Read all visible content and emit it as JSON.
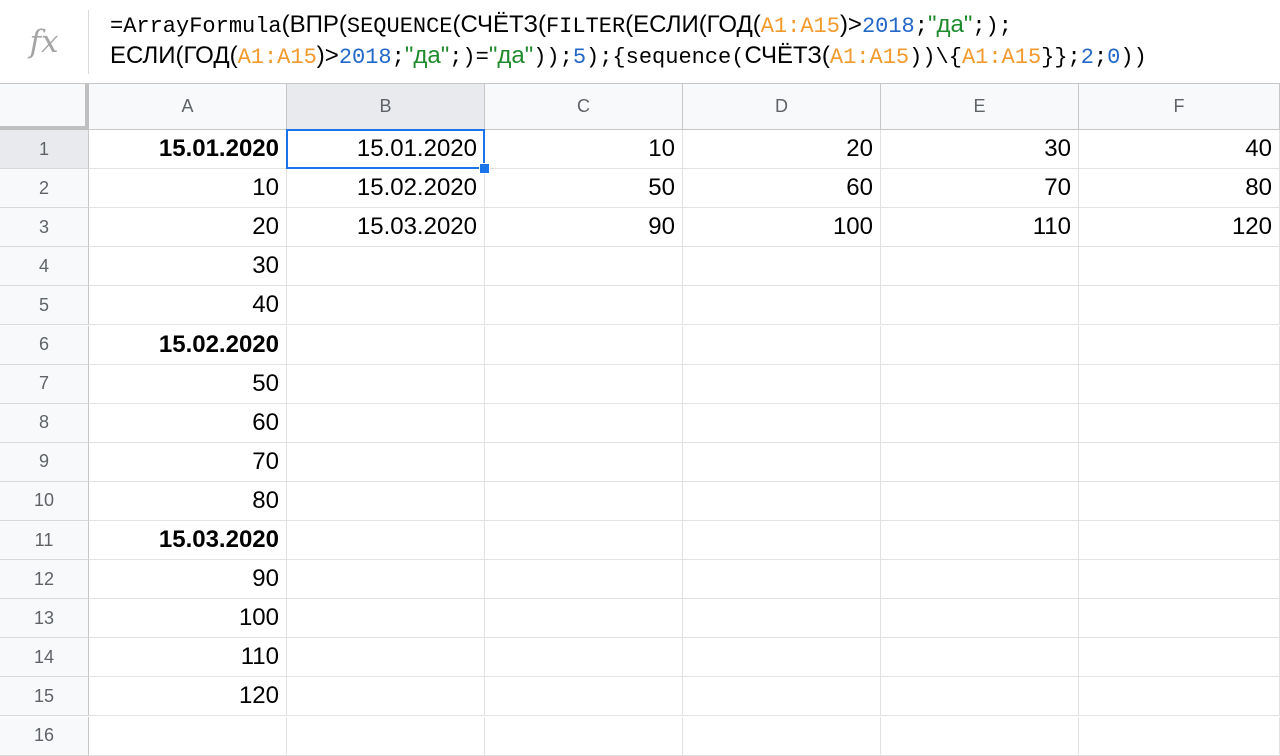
{
  "formula_bar": {
    "icon": "fx-icon",
    "icon_label": "fx",
    "line1": [
      {
        "t": "=ArrayFormula",
        "c": "plain",
        "f": "mono"
      },
      {
        "t": "(ВПР(",
        "c": "plain",
        "f": "sans"
      },
      {
        "t": "SEQUENCE",
        "c": "plain",
        "f": "mono"
      },
      {
        "t": "(СЧЁТЗ(",
        "c": "plain",
        "f": "sans"
      },
      {
        "t": "FILTER",
        "c": "plain",
        "f": "mono"
      },
      {
        "t": "(ЕСЛИ(ГОД(",
        "c": "plain",
        "f": "sans"
      },
      {
        "t": "A1:A15",
        "c": "ref",
        "f": "mono"
      },
      {
        "t": ")>",
        "c": "plain",
        "f": "sans"
      },
      {
        "t": "2018",
        "c": "num",
        "f": "mono"
      },
      {
        "t": ";",
        "c": "plain",
        "f": "mono"
      },
      {
        "t": "\"да\"",
        "c": "str",
        "f": "sans"
      },
      {
        "t": ";);",
        "c": "plain",
        "f": "mono"
      }
    ],
    "line2": [
      {
        "t": "ЕСЛИ(ГОД(",
        "c": "plain",
        "f": "sans"
      },
      {
        "t": "A1:A15",
        "c": "ref",
        "f": "mono"
      },
      {
        "t": ")>",
        "c": "plain",
        "f": "sans"
      },
      {
        "t": "2018",
        "c": "num",
        "f": "mono"
      },
      {
        "t": ";",
        "c": "plain",
        "f": "mono"
      },
      {
        "t": "\"да\"",
        "c": "str",
        "f": "sans"
      },
      {
        "t": ";)=",
        "c": "plain",
        "f": "mono"
      },
      {
        "t": "\"да\"",
        "c": "str",
        "f": "sans"
      },
      {
        "t": "));",
        "c": "plain",
        "f": "mono"
      },
      {
        "t": "5",
        "c": "num",
        "f": "mono"
      },
      {
        "t": ");{sequence(",
        "c": "plain",
        "f": "mono"
      },
      {
        "t": "СЧЁТЗ(",
        "c": "plain",
        "f": "sans"
      },
      {
        "t": "A1:A15",
        "c": "ref",
        "f": "mono"
      },
      {
        "t": "))\\{",
        "c": "plain",
        "f": "mono"
      },
      {
        "t": "A1:A15",
        "c": "ref",
        "f": "mono"
      },
      {
        "t": "}};",
        "c": "plain",
        "f": "mono"
      },
      {
        "t": "2",
        "c": "num",
        "f": "mono"
      },
      {
        "t": ";",
        "c": "plain",
        "f": "mono"
      },
      {
        "t": "0",
        "c": "num",
        "f": "mono"
      },
      {
        "t": "))",
        "c": "plain",
        "f": "mono"
      }
    ]
  },
  "colors": {
    "ref": "#f29a2e",
    "num": "#2367c7",
    "str": "#1f8a2c",
    "selection": "#1a73e8"
  },
  "columns": [
    "A",
    "B",
    "C",
    "D",
    "E",
    "F"
  ],
  "rows": [
    "1",
    "2",
    "3",
    "4",
    "5",
    "6",
    "7",
    "8",
    "9",
    "10",
    "11",
    "12",
    "13",
    "14",
    "15",
    "16"
  ],
  "selected_cell": {
    "col": "B",
    "row": "1"
  },
  "cells": [
    [
      "15.01.2020",
      "15.01.2020",
      "10",
      "20",
      "30",
      "40"
    ],
    [
      "10",
      "15.02.2020",
      "50",
      "60",
      "70",
      "80"
    ],
    [
      "20",
      "15.03.2020",
      "90",
      "100",
      "110",
      "120"
    ],
    [
      "30",
      "",
      "",
      "",
      "",
      ""
    ],
    [
      "40",
      "",
      "",
      "",
      "",
      ""
    ],
    [
      "15.02.2020",
      "",
      "",
      "",
      "",
      ""
    ],
    [
      "50",
      "",
      "",
      "",
      "",
      ""
    ],
    [
      "60",
      "",
      "",
      "",
      "",
      ""
    ],
    [
      "70",
      "",
      "",
      "",
      "",
      ""
    ],
    [
      "80",
      "",
      "",
      "",
      "",
      ""
    ],
    [
      "15.03.2020",
      "",
      "",
      "",
      "",
      ""
    ],
    [
      "90",
      "",
      "",
      "",
      "",
      ""
    ],
    [
      "100",
      "",
      "",
      "",
      "",
      ""
    ],
    [
      "110",
      "",
      "",
      "",
      "",
      ""
    ],
    [
      "120",
      "",
      "",
      "",
      "",
      ""
    ],
    [
      "",
      "",
      "",
      "",
      "",
      ""
    ]
  ],
  "bold_cells": [
    "A1",
    "A6",
    "A11"
  ]
}
